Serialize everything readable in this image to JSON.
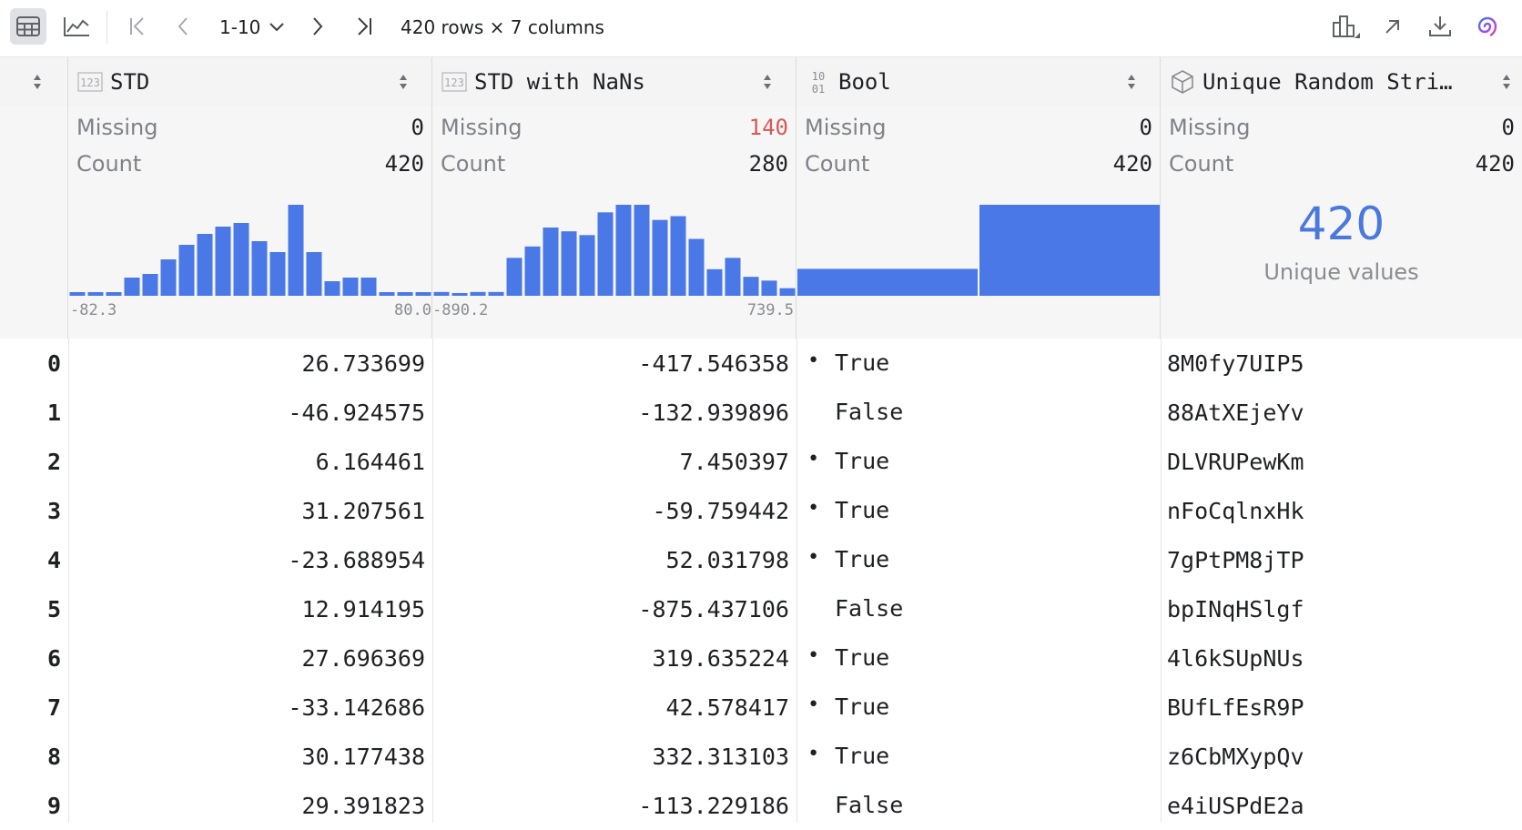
{
  "toolbar": {
    "table_view_icon": "table-grid-icon",
    "chart_view_icon": "line-chart-icon",
    "pagination_range": "1-10",
    "summary": "420 rows × 7 columns"
  },
  "columns": [
    {
      "name": "STD",
      "type_icon": "numeric-123-icon"
    },
    {
      "name": "STD with NaNs",
      "type_icon": "numeric-123-icon"
    },
    {
      "name": "Bool",
      "type_icon": "binary-1001-icon"
    },
    {
      "name": "Unique Random Stri…",
      "type_icon": "cube-object-icon"
    }
  ],
  "stats": {
    "missing_label": "Missing",
    "count_label": "Count",
    "std": {
      "missing": "0",
      "count": "420",
      "min": "-82.3",
      "max": "80.0"
    },
    "nan": {
      "missing": "140",
      "count": "280",
      "min": "-890.2",
      "max": "739.5"
    },
    "bool": {
      "missing": "0",
      "count": "420"
    },
    "str": {
      "missing": "0",
      "count": "420",
      "unique_count": "420",
      "unique_label": "Unique values"
    }
  },
  "histograms": {
    "std_bins": [
      1,
      1,
      1,
      5,
      6,
      10,
      14,
      17,
      19,
      20,
      15,
      12,
      25,
      12,
      4,
      5,
      5,
      1,
      1,
      1
    ],
    "nan_bins": [
      1,
      0,
      1,
      1,
      10,
      13,
      18,
      17,
      16,
      22,
      24,
      24,
      20,
      21,
      15,
      7,
      10,
      5,
      4,
      2
    ],
    "bool_bins": [
      29,
      98
    ]
  },
  "colors": {
    "bar": "#4a78e6",
    "warn": "#d55a55",
    "accent": "#4a78dd"
  },
  "rows": [
    {
      "idx": "0",
      "std": "26.733699",
      "nan": "-417.546358",
      "bool": "True",
      "str": "8M0fy7UIP5"
    },
    {
      "idx": "1",
      "std": "-46.924575",
      "nan": "-132.939896",
      "bool": "False",
      "str": "88AtXEjeYv"
    },
    {
      "idx": "2",
      "std": "6.164461",
      "nan": "7.450397",
      "bool": "True",
      "str": "DLVRUPewKm"
    },
    {
      "idx": "3",
      "std": "31.207561",
      "nan": "-59.759442",
      "bool": "True",
      "str": "nFoCqlnxHk"
    },
    {
      "idx": "4",
      "std": "-23.688954",
      "nan": "52.031798",
      "bool": "True",
      "str": "7gPtPM8jTP"
    },
    {
      "idx": "5",
      "std": "12.914195",
      "nan": "-875.437106",
      "bool": "False",
      "str": "bpINqHSlgf"
    },
    {
      "idx": "6",
      "std": "27.696369",
      "nan": "319.635224",
      "bool": "True",
      "str": "4l6kSUpNUs"
    },
    {
      "idx": "7",
      "std": "-33.142686",
      "nan": "42.578417",
      "bool": "True",
      "str": "BUfLfEsR9P"
    },
    {
      "idx": "8",
      "std": "30.177438",
      "nan": "332.313103",
      "bool": "True",
      "str": "z6CbMXypQv"
    },
    {
      "idx": "9",
      "std": "29.391823",
      "nan": "-113.229186",
      "bool": "False",
      "str": "e4iUSPdE2a"
    }
  ]
}
